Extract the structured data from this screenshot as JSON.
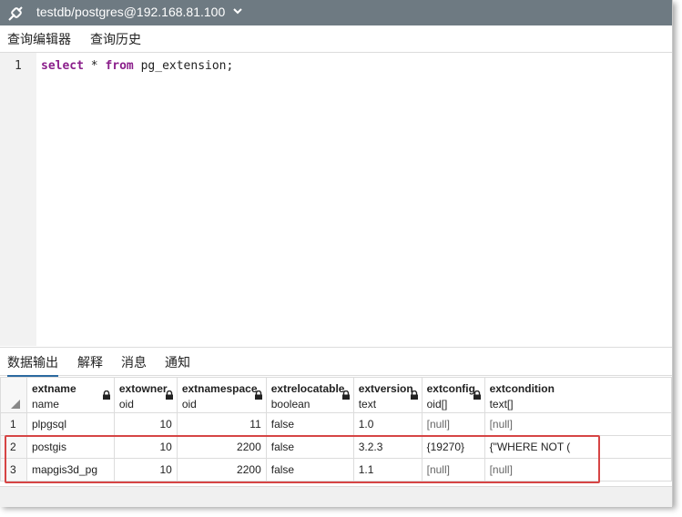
{
  "window": {
    "title": "testdb/postgres@192.168.81.100"
  },
  "query_tabs": [
    {
      "label": "查询编辑器"
    },
    {
      "label": "查询历史"
    }
  ],
  "editor": {
    "line_number": "1",
    "kw_select": "select",
    "star": " * ",
    "kw_from": "from",
    "rest": " pg_extension;"
  },
  "result_tabs": [
    {
      "label": "数据输出"
    },
    {
      "label": "解释"
    },
    {
      "label": "消息"
    },
    {
      "label": "通知"
    }
  ],
  "columns": [
    {
      "name": "extname",
      "type": "name"
    },
    {
      "name": "extowner",
      "type": "oid"
    },
    {
      "name": "extnamespace",
      "type": "oid"
    },
    {
      "name": "extrelocatable",
      "type": "boolean"
    },
    {
      "name": "extversion",
      "type": "text"
    },
    {
      "name": "extconfig",
      "type": "oid[]"
    },
    {
      "name": "extcondition",
      "type": "text[]"
    }
  ],
  "rows": [
    {
      "n": "1",
      "cells": [
        "plpgsql",
        "10",
        "11",
        "false",
        "1.0",
        "[null]",
        "[null]"
      ]
    },
    {
      "n": "2",
      "cells": [
        "postgis",
        "10",
        "2200",
        "false",
        "3.2.3",
        "{19270}",
        "{\"WHERE NOT ("
      ]
    },
    {
      "n": "3",
      "cells": [
        "mapgis3d_pg",
        "10",
        "2200",
        "false",
        "1.1",
        "[null]",
        "[null]"
      ]
    }
  ],
  "colors": {
    "titlebar": "#6e7a82",
    "active_tab": "#2c6aa0",
    "highlight": "#d64545",
    "keyword": "#8b1f8b"
  }
}
